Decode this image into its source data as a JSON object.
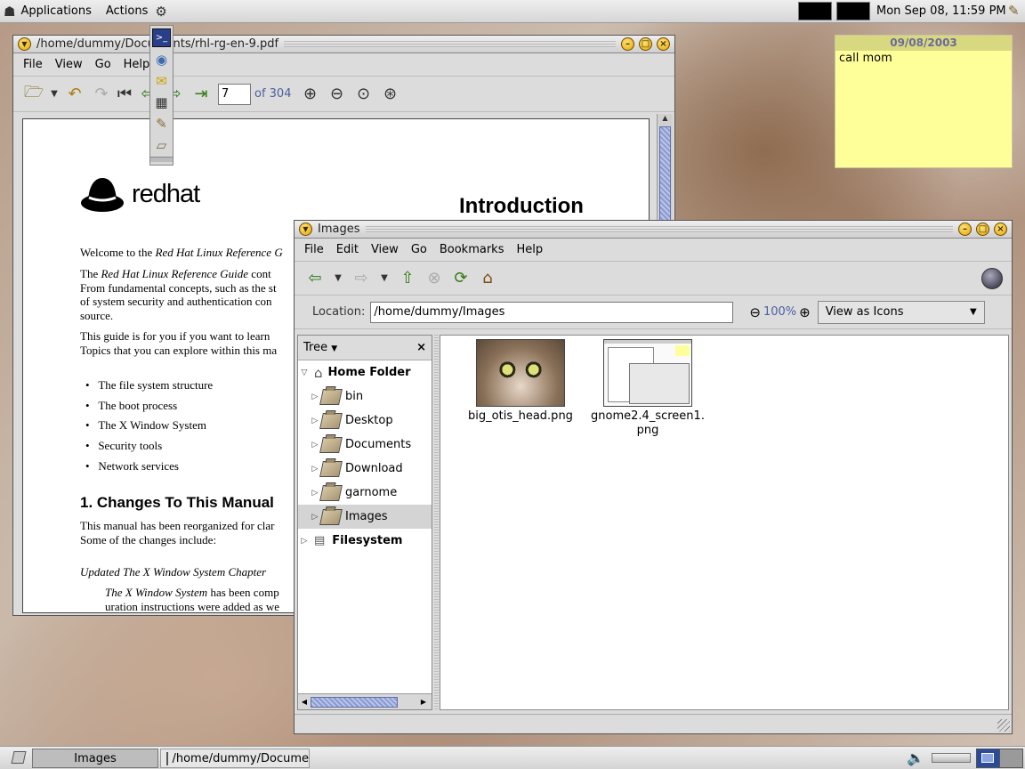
{
  "top_panel": {
    "applications": "Applications",
    "actions": "Actions",
    "clock": "Mon Sep 08, 11:59 PM"
  },
  "pdf_window": {
    "title": "/home/dummy/Documents/rhl-rg-en-9.pdf",
    "menu": [
      "File",
      "View",
      "Go",
      "Help"
    ],
    "page_input": "7",
    "page_of": "of 304",
    "doc": {
      "logo": "redhat",
      "heading": "Introduction",
      "p1_start": "Welcome to the ",
      "p1_italic": "Red Hat Linux Reference G",
      "p2_start": "The ",
      "p2_italic": "Red Hat Linux Reference Guide",
      "p2_rest": " cont",
      "p2_line2": "From fundamental concepts, such as the st",
      "p2_line3": "of system security and authentication con",
      "p2_line4": "source.",
      "p3_line1": "This guide is for you if you want to learn",
      "p3_line2": "Topics that you can explore within this ma",
      "bullets": [
        "The file system structure",
        "The boot process",
        "The X Window System",
        "Security tools",
        "Network services"
      ],
      "section": "1. Changes To This Manual",
      "p4_line1": "This manual has been reorganized for clar",
      "p4_line2": "Some of the changes include:",
      "sub_italic": "Updated The X Window System Chapter",
      "p5_italic": "The X Window System",
      "p5_rest": " has been comp",
      "p5_line2": "uration instructions were added as we"
    }
  },
  "images_window": {
    "title": "Images",
    "menu": [
      "File",
      "Edit",
      "View",
      "Go",
      "Bookmarks",
      "Help"
    ],
    "location_label": "Location:",
    "location_value": "/home/dummy/Images",
    "zoom": "100%",
    "view_as": "View as Icons",
    "sidebar_title": "Tree",
    "sidebar_close": "×",
    "tree": {
      "home": "Home Folder",
      "items": [
        "bin",
        "Desktop",
        "Documents",
        "Download",
        "garnome",
        "Images"
      ],
      "filesystem": "Filesystem"
    },
    "files": [
      {
        "name": "big_otis_head.png"
      },
      {
        "name_line1": "gnome2.4_screen1.",
        "name_line2": "png"
      }
    ]
  },
  "sticky_note": {
    "date": "09/08/2003",
    "text": "call mom"
  },
  "taskbar": {
    "task1": "Images",
    "task2": "/home/dummy/Docume"
  }
}
